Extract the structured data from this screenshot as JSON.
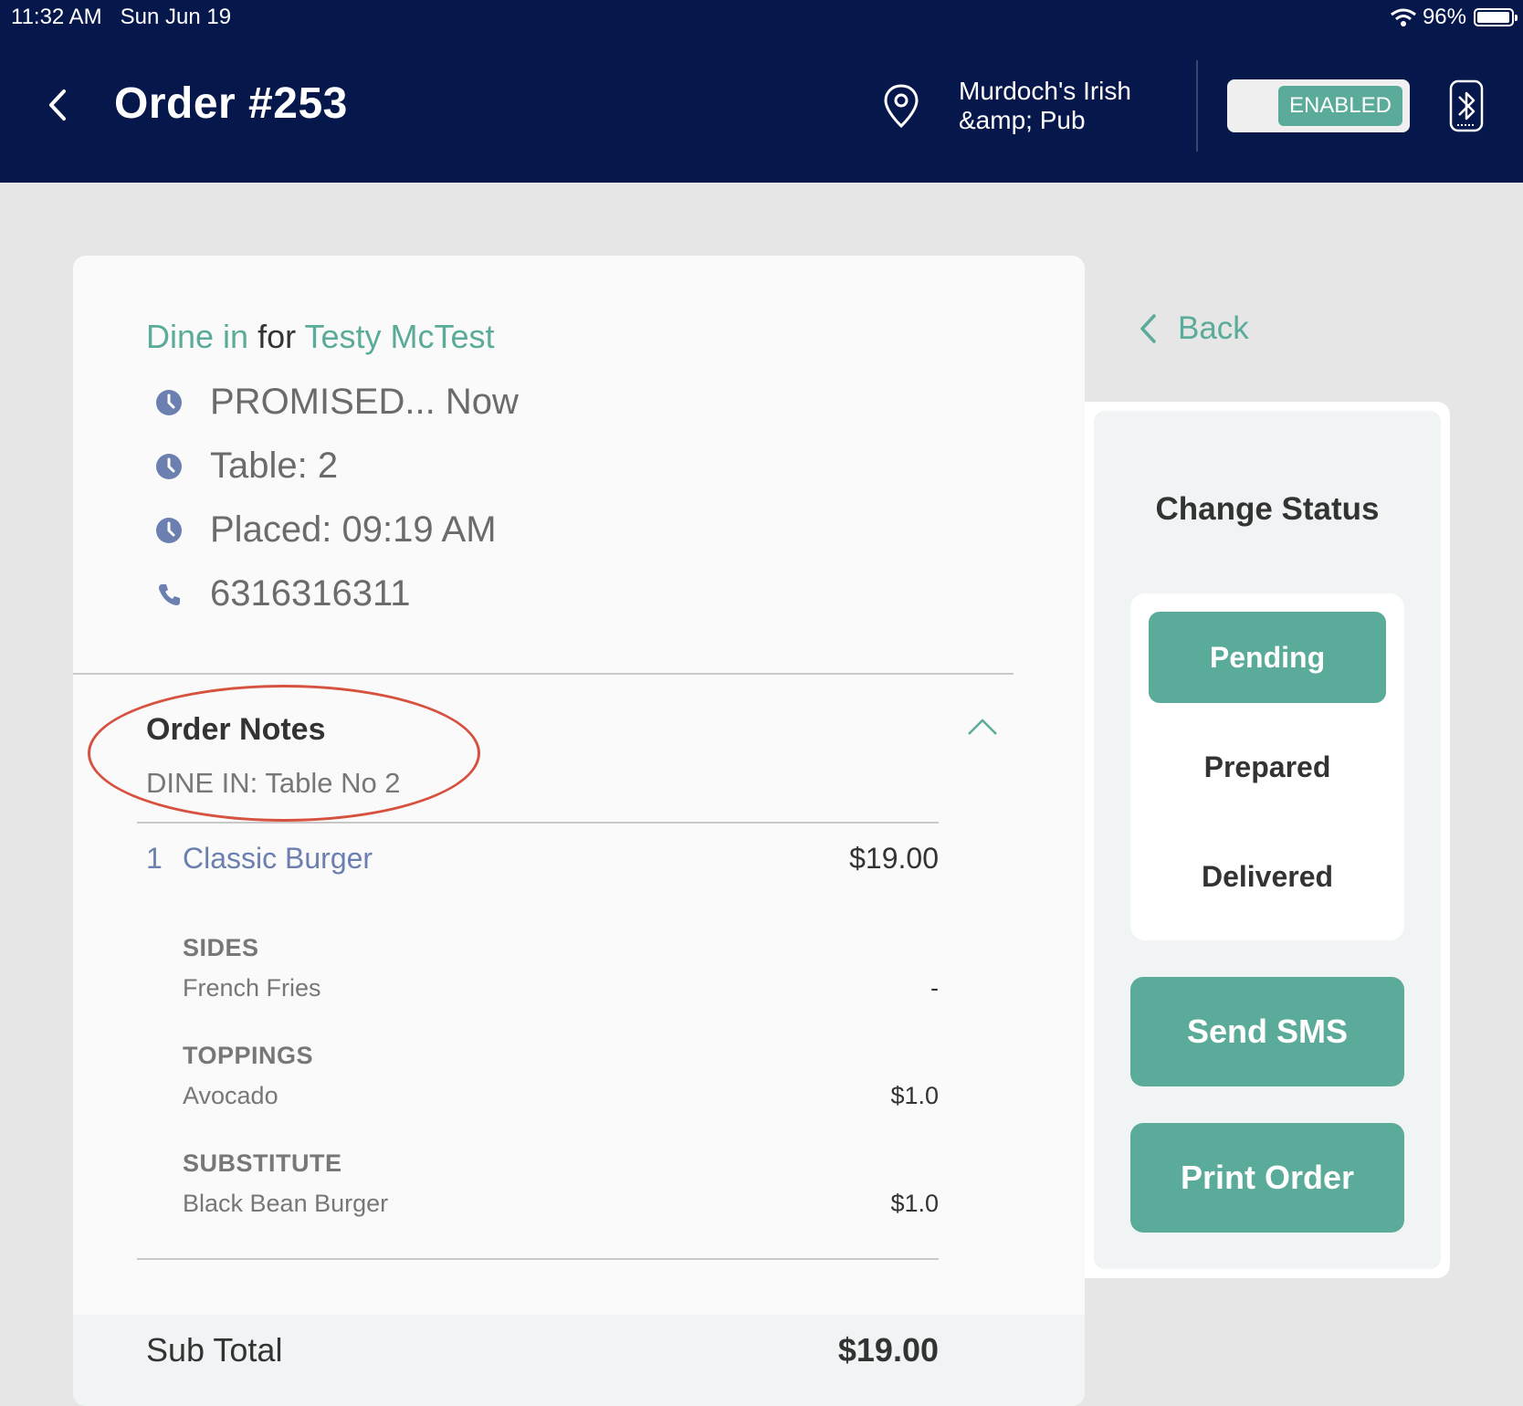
{
  "status_bar": {
    "time": "11:32 AM",
    "date": "Sun Jun 19",
    "battery": "96%",
    "battery_level": 0.96
  },
  "header": {
    "title": "Order #253",
    "location": "Murdoch's Irish &amp; Pub",
    "toggle_label": "ENABLED",
    "icons": [
      "chevron-left-icon",
      "map-pin-icon",
      "bluetooth-icon"
    ]
  },
  "order": {
    "type": "Dine in",
    "for_word": "for",
    "customer": "Testy McTest",
    "info": [
      {
        "icon": "clock-icon",
        "text": "PROMISED... Now"
      },
      {
        "icon": "clock-icon",
        "text": "Table: 2"
      },
      {
        "icon": "clock-icon",
        "text": "Placed: 09:19 AM"
      },
      {
        "icon": "phone-icon",
        "text": "6316316311"
      }
    ],
    "notes": {
      "title": "Order Notes",
      "text": "DINE IN: Table No 2"
    },
    "items": [
      {
        "qty": "1",
        "name": "Classic Burger",
        "price": "$19.00",
        "modifiers": [
          {
            "group": "SIDES",
            "value": "French Fries",
            "price": "-"
          },
          {
            "group": "TOPPINGS",
            "value": "Avocado",
            "price": "$1.0"
          },
          {
            "group": "SUBSTITUTE",
            "value": "Black Bean Burger",
            "price": "$1.0"
          }
        ]
      }
    ],
    "subtotal_label": "Sub Total",
    "subtotal_value": "$19.00"
  },
  "sidebar": {
    "back_label": "Back",
    "title": "Change Status",
    "statuses": [
      {
        "label": "Pending",
        "active": true
      },
      {
        "label": "Prepared",
        "active": false
      },
      {
        "label": "Delivered",
        "active": false
      }
    ],
    "send_sms": "Send SMS",
    "print_order": "Print Order"
  },
  "colors": {
    "header_bg": "#06174b",
    "accent": "#5aab99",
    "item_link": "#6b7fb0",
    "annotation": "#d6513e",
    "page_bg": "#e6e6e6"
  }
}
